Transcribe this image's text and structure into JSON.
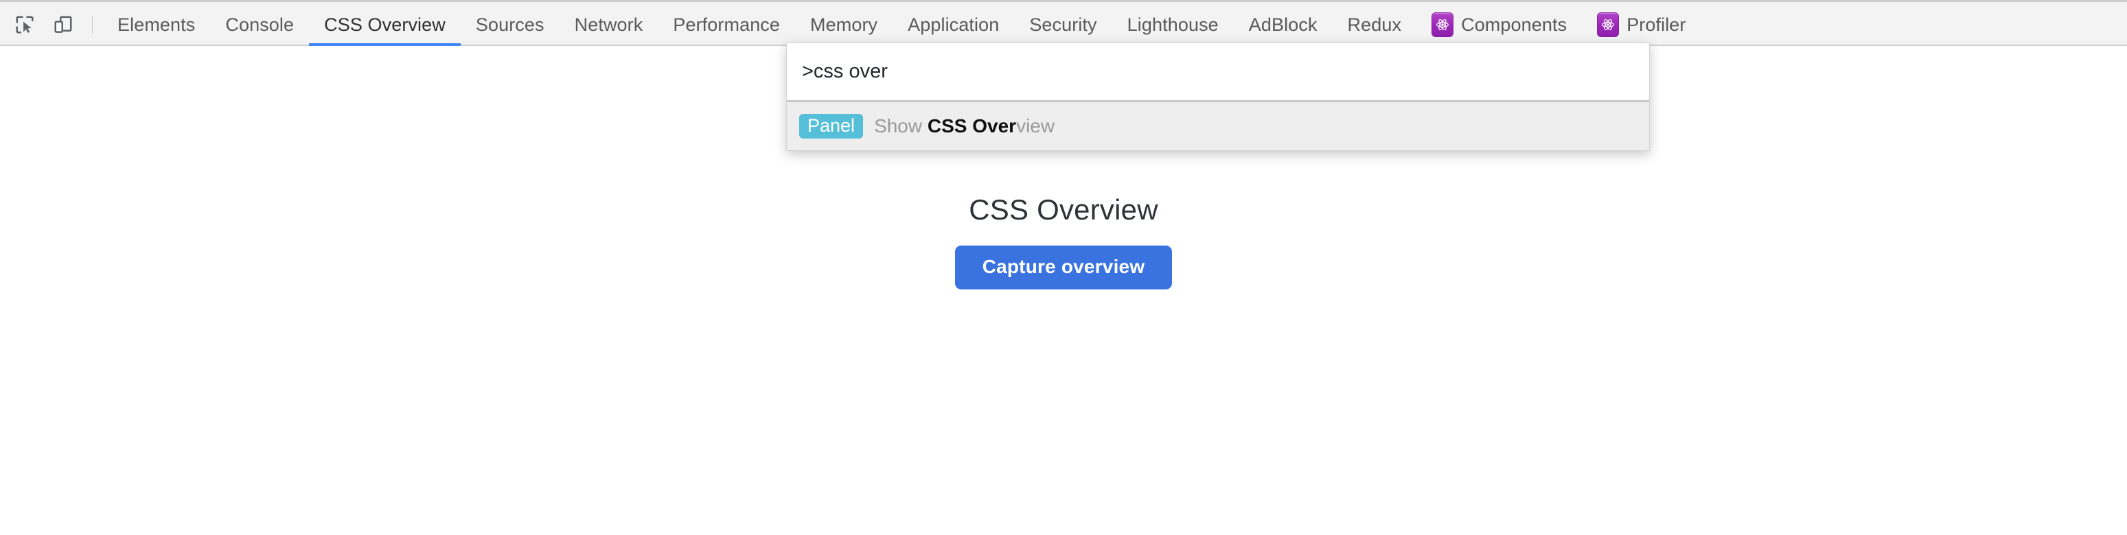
{
  "toolbar": {
    "inspect_icon": "inspect-cursor-icon",
    "device_icon": "device-toolbar-icon",
    "tabs": [
      {
        "label": "Elements",
        "active": false,
        "icon": null
      },
      {
        "label": "Console",
        "active": false,
        "icon": null
      },
      {
        "label": "CSS Overview",
        "active": true,
        "icon": null
      },
      {
        "label": "Sources",
        "active": false,
        "icon": null
      },
      {
        "label": "Network",
        "active": false,
        "icon": null
      },
      {
        "label": "Performance",
        "active": false,
        "icon": null
      },
      {
        "label": "Memory",
        "active": false,
        "icon": null
      },
      {
        "label": "Application",
        "active": false,
        "icon": null
      },
      {
        "label": "Security",
        "active": false,
        "icon": null
      },
      {
        "label": "Lighthouse",
        "active": false,
        "icon": null
      },
      {
        "label": "AdBlock",
        "active": false,
        "icon": null
      },
      {
        "label": "Redux",
        "active": false,
        "icon": null
      },
      {
        "label": "Components",
        "active": false,
        "icon": "react-atom-icon"
      },
      {
        "label": "Profiler",
        "active": false,
        "icon": "react-atom-icon"
      }
    ]
  },
  "palette": {
    "input_value": ">css over",
    "input_placeholder": "",
    "results": [
      {
        "badge": "Panel",
        "prefix": "Show ",
        "match": "CSS Over",
        "suffix": "view"
      }
    ]
  },
  "main": {
    "title": "CSS Overview",
    "capture_button": "Capture overview"
  },
  "colors": {
    "accent_blue": "#3a73e0",
    "tab_underline": "#4285f4",
    "badge_teal": "#55bfda",
    "react_purple": "#9b28b8",
    "toolbar_bg": "#f3f3f3",
    "results_bg": "#eeeeee"
  }
}
